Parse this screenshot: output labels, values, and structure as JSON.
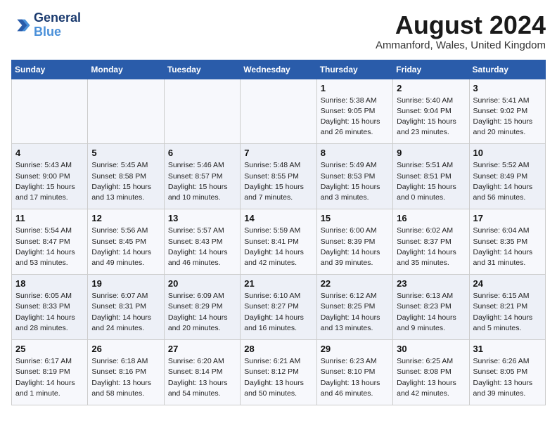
{
  "logo": {
    "line1": "General",
    "line2": "Blue"
  },
  "title": "August 2024",
  "subtitle": "Ammanford, Wales, United Kingdom",
  "days_header": [
    "Sunday",
    "Monday",
    "Tuesday",
    "Wednesday",
    "Thursday",
    "Friday",
    "Saturday"
  ],
  "weeks": [
    [
      {
        "day": "",
        "info": ""
      },
      {
        "day": "",
        "info": ""
      },
      {
        "day": "",
        "info": ""
      },
      {
        "day": "",
        "info": ""
      },
      {
        "day": "1",
        "info": "Sunrise: 5:38 AM\nSunset: 9:05 PM\nDaylight: 15 hours\nand 26 minutes."
      },
      {
        "day": "2",
        "info": "Sunrise: 5:40 AM\nSunset: 9:04 PM\nDaylight: 15 hours\nand 23 minutes."
      },
      {
        "day": "3",
        "info": "Sunrise: 5:41 AM\nSunset: 9:02 PM\nDaylight: 15 hours\nand 20 minutes."
      }
    ],
    [
      {
        "day": "4",
        "info": "Sunrise: 5:43 AM\nSunset: 9:00 PM\nDaylight: 15 hours\nand 17 minutes."
      },
      {
        "day": "5",
        "info": "Sunrise: 5:45 AM\nSunset: 8:58 PM\nDaylight: 15 hours\nand 13 minutes."
      },
      {
        "day": "6",
        "info": "Sunrise: 5:46 AM\nSunset: 8:57 PM\nDaylight: 15 hours\nand 10 minutes."
      },
      {
        "day": "7",
        "info": "Sunrise: 5:48 AM\nSunset: 8:55 PM\nDaylight: 15 hours\nand 7 minutes."
      },
      {
        "day": "8",
        "info": "Sunrise: 5:49 AM\nSunset: 8:53 PM\nDaylight: 15 hours\nand 3 minutes."
      },
      {
        "day": "9",
        "info": "Sunrise: 5:51 AM\nSunset: 8:51 PM\nDaylight: 15 hours\nand 0 minutes."
      },
      {
        "day": "10",
        "info": "Sunrise: 5:52 AM\nSunset: 8:49 PM\nDaylight: 14 hours\nand 56 minutes."
      }
    ],
    [
      {
        "day": "11",
        "info": "Sunrise: 5:54 AM\nSunset: 8:47 PM\nDaylight: 14 hours\nand 53 minutes."
      },
      {
        "day": "12",
        "info": "Sunrise: 5:56 AM\nSunset: 8:45 PM\nDaylight: 14 hours\nand 49 minutes."
      },
      {
        "day": "13",
        "info": "Sunrise: 5:57 AM\nSunset: 8:43 PM\nDaylight: 14 hours\nand 46 minutes."
      },
      {
        "day": "14",
        "info": "Sunrise: 5:59 AM\nSunset: 8:41 PM\nDaylight: 14 hours\nand 42 minutes."
      },
      {
        "day": "15",
        "info": "Sunrise: 6:00 AM\nSunset: 8:39 PM\nDaylight: 14 hours\nand 39 minutes."
      },
      {
        "day": "16",
        "info": "Sunrise: 6:02 AM\nSunset: 8:37 PM\nDaylight: 14 hours\nand 35 minutes."
      },
      {
        "day": "17",
        "info": "Sunrise: 6:04 AM\nSunset: 8:35 PM\nDaylight: 14 hours\nand 31 minutes."
      }
    ],
    [
      {
        "day": "18",
        "info": "Sunrise: 6:05 AM\nSunset: 8:33 PM\nDaylight: 14 hours\nand 28 minutes."
      },
      {
        "day": "19",
        "info": "Sunrise: 6:07 AM\nSunset: 8:31 PM\nDaylight: 14 hours\nand 24 minutes."
      },
      {
        "day": "20",
        "info": "Sunrise: 6:09 AM\nSunset: 8:29 PM\nDaylight: 14 hours\nand 20 minutes."
      },
      {
        "day": "21",
        "info": "Sunrise: 6:10 AM\nSunset: 8:27 PM\nDaylight: 14 hours\nand 16 minutes."
      },
      {
        "day": "22",
        "info": "Sunrise: 6:12 AM\nSunset: 8:25 PM\nDaylight: 14 hours\nand 13 minutes."
      },
      {
        "day": "23",
        "info": "Sunrise: 6:13 AM\nSunset: 8:23 PM\nDaylight: 14 hours\nand 9 minutes."
      },
      {
        "day": "24",
        "info": "Sunrise: 6:15 AM\nSunset: 8:21 PM\nDaylight: 14 hours\nand 5 minutes."
      }
    ],
    [
      {
        "day": "25",
        "info": "Sunrise: 6:17 AM\nSunset: 8:19 PM\nDaylight: 14 hours\nand 1 minute."
      },
      {
        "day": "26",
        "info": "Sunrise: 6:18 AM\nSunset: 8:16 PM\nDaylight: 13 hours\nand 58 minutes."
      },
      {
        "day": "27",
        "info": "Sunrise: 6:20 AM\nSunset: 8:14 PM\nDaylight: 13 hours\nand 54 minutes."
      },
      {
        "day": "28",
        "info": "Sunrise: 6:21 AM\nSunset: 8:12 PM\nDaylight: 13 hours\nand 50 minutes."
      },
      {
        "day": "29",
        "info": "Sunrise: 6:23 AM\nSunset: 8:10 PM\nDaylight: 13 hours\nand 46 minutes."
      },
      {
        "day": "30",
        "info": "Sunrise: 6:25 AM\nSunset: 8:08 PM\nDaylight: 13 hours\nand 42 minutes."
      },
      {
        "day": "31",
        "info": "Sunrise: 6:26 AM\nSunset: 8:05 PM\nDaylight: 13 hours\nand 39 minutes."
      }
    ]
  ]
}
